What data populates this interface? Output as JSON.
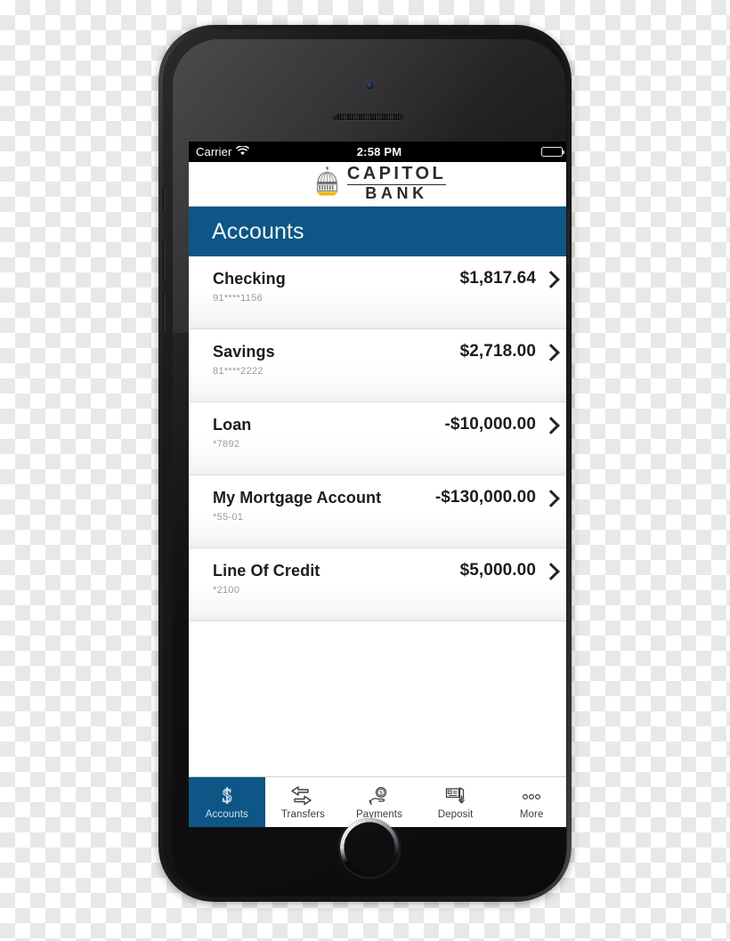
{
  "device": {
    "type": "smartphone",
    "orientation": "portrait"
  },
  "status_bar": {
    "carrier": "Carrier",
    "wifi_icon": "wifi-icon",
    "time": "2:58 PM",
    "battery_icon": "battery-full-icon"
  },
  "brand": {
    "logo_icon": "capitol-dome-icon",
    "line1": "CAPITOL",
    "line2": "BANK",
    "dome_color": "#6e6e6e",
    "base_color": "#f3b41c"
  },
  "header": {
    "title": "Accounts",
    "background": "#0d5685",
    "text_color": "#f2f6f9"
  },
  "accounts": [
    {
      "name": "Checking",
      "number": "91****1156",
      "balance": "$1,817.64",
      "chevron": "chevron-right-icon"
    },
    {
      "name": "Savings",
      "number": "81****2222",
      "balance": "$2,718.00",
      "chevron": "chevron-right-icon"
    },
    {
      "name": "Loan",
      "number": "*7892",
      "balance": "-$10,000.00",
      "chevron": "chevron-right-icon"
    },
    {
      "name": "My Mortgage Account",
      "number": "*55-01",
      "balance": "-$130,000.00",
      "chevron": "chevron-right-icon"
    },
    {
      "name": "Line Of Credit",
      "number": "*2100",
      "balance": "$5,000.00",
      "chevron": "chevron-right-icon"
    }
  ],
  "tab_bar": {
    "active_index": 0,
    "active_background": "#0d5685",
    "items": [
      {
        "label": "Accounts",
        "icon": "dollar-sign-icon"
      },
      {
        "label": "Transfers",
        "icon": "transfer-arrows-icon"
      },
      {
        "label": "Payments",
        "icon": "hand-holding-coin-icon"
      },
      {
        "label": "Deposit",
        "icon": "check-deposit-icon"
      },
      {
        "label": "More",
        "icon": "ellipsis-icon"
      }
    ]
  }
}
